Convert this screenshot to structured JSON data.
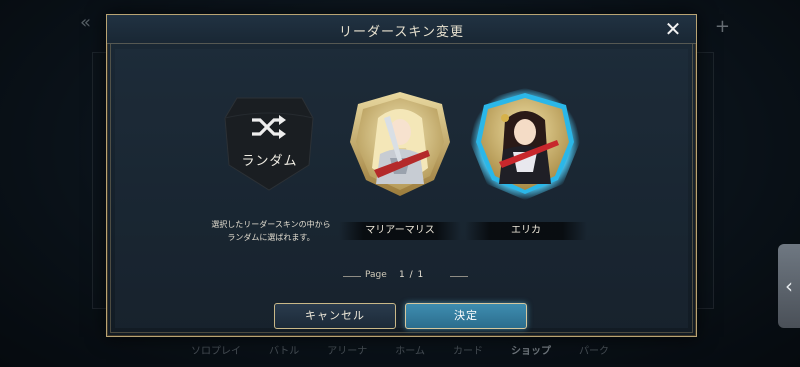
{
  "dialog": {
    "title": "リーダースキン変更",
    "close_label": "✕"
  },
  "random_option": {
    "label": "ランダム",
    "description_line1": "選択したリーダースキンの中から",
    "description_line2": "ランダムに選ばれます。"
  },
  "skins": [
    {
      "name": "マリアーマリス"
    },
    {
      "name": "エリカ"
    }
  ],
  "pager": {
    "label": "Page",
    "value": "1 / 1"
  },
  "buttons": {
    "cancel": "キャンセル",
    "confirm": "決定"
  },
  "background_nav": {
    "items": [
      "ソロプレイ",
      "バトル",
      "アリーナ",
      "ホーム",
      "カード",
      "ショップ",
      "パーク"
    ]
  },
  "colors": {
    "gold_border": "#b9a474",
    "selected_glow": "#4fd2ff",
    "confirm_button": "#3e8db0"
  }
}
